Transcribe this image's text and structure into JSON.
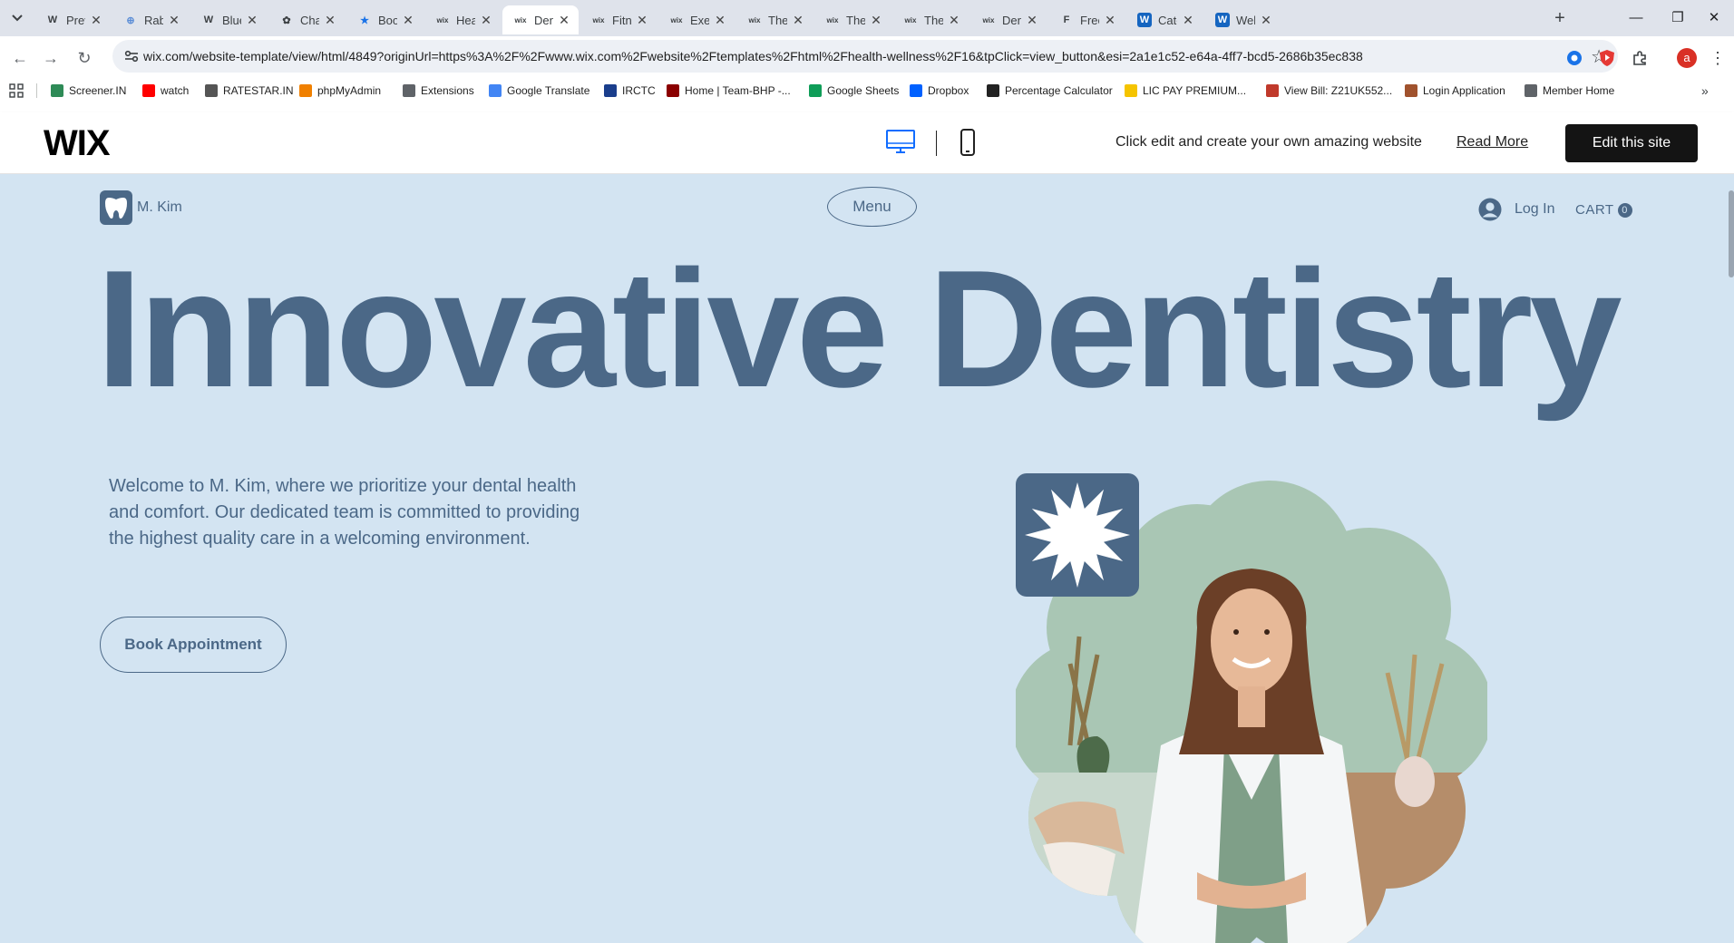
{
  "browser": {
    "tabs": [
      {
        "title": "Preval",
        "icon": "wikipedia-icon",
        "glyph": "W"
      },
      {
        "title": "Rabies",
        "icon": "globe-icon",
        "glyph": "⊕"
      },
      {
        "title": "Blue C",
        "icon": "wikipedia-icon",
        "glyph": "W"
      },
      {
        "title": "ChatG",
        "icon": "chatgpt-icon",
        "glyph": "✿"
      },
      {
        "title": "Bookn",
        "icon": "bookmark-star-icon",
        "glyph": "★"
      },
      {
        "title": "Health",
        "icon": "wix-favicon-icon",
        "glyph": "wix"
      },
      {
        "title": "Dentis",
        "icon": "wix-favicon-icon",
        "glyph": "wix"
      },
      {
        "title": "Fitnes",
        "icon": "wix-favicon-icon",
        "glyph": "wix"
      },
      {
        "title": "Exerci",
        "icon": "wix-favicon-icon",
        "glyph": "wix"
      },
      {
        "title": "Thera",
        "icon": "wix-favicon-icon",
        "glyph": "wix"
      },
      {
        "title": "Thera",
        "icon": "wix-favicon-icon",
        "glyph": "wix"
      },
      {
        "title": "Thera",
        "icon": "wix-favicon-icon",
        "glyph": "wix"
      },
      {
        "title": "Dentis",
        "icon": "wix-favicon-icon",
        "glyph": "wix"
      },
      {
        "title": "Free C",
        "icon": "framer-icon",
        "glyph": "F"
      },
      {
        "title": "Categ",
        "icon": "webflow-icon",
        "glyph": "W"
      },
      {
        "title": "Welln",
        "icon": "webflow-icon",
        "glyph": "W"
      }
    ],
    "active_tab_index": 6,
    "url": "wix.com/website-template/view/html/4849?originUrl=https%3A%2F%2Fwww.wix.com%2Fwebsite%2Ftemplates%2Fhtml%2Fhealth-wellness%2F16&tpClick=view_button&esi=2a1e1c52-e64a-4ff7-bcd5-2686b35ec838",
    "profile_initial": "a",
    "bookmarks": [
      {
        "label": "Screener.IN",
        "icon": "bar-chart-icon",
        "color": "#2e8b57"
      },
      {
        "label": "watch",
        "icon": "youtube-icon",
        "color": "#ff0000"
      },
      {
        "label": "RATESTAR.IN",
        "icon": "star-burst-icon",
        "color": "#555555"
      },
      {
        "label": "phpMyAdmin",
        "icon": "phpmyadmin-icon",
        "color": "#f08000"
      },
      {
        "label": "Extensions",
        "icon": "puzzle-icon",
        "color": "#5f6368"
      },
      {
        "label": "Google Translate",
        "icon": "translate-icon",
        "color": "#4285f4"
      },
      {
        "label": "IRCTC",
        "icon": "irctc-icon",
        "color": "#1a3e8c"
      },
      {
        "label": "Home | Team-BHP -...",
        "icon": "team-bhp-icon",
        "color": "#8b0000"
      },
      {
        "label": "Google Sheets",
        "icon": "sheets-icon",
        "color": "#0f9d58"
      },
      {
        "label": "Dropbox",
        "icon": "dropbox-icon",
        "color": "#0061ff"
      },
      {
        "label": "Percentage Calculator",
        "icon": "percent-icon",
        "color": "#222222"
      },
      {
        "label": "LIC PAY PREMIUM...",
        "icon": "lic-icon",
        "color": "#f5c400"
      },
      {
        "label": "View Bill: Z21UK552...",
        "icon": "bill-icon",
        "color": "#c0392b"
      },
      {
        "label": "Login Application",
        "icon": "login-app-icon",
        "color": "#a0522d"
      },
      {
        "label": "Member Home",
        "icon": "globe-icon",
        "color": "#5f6368"
      }
    ]
  },
  "wix_bar": {
    "logo": "WIX",
    "tagline": "Click edit and create your own amazing website",
    "read_more": "Read More",
    "edit_button": "Edit this site"
  },
  "site": {
    "brand_name": "M. Kim",
    "menu_label": "Menu",
    "login_label": "Log In",
    "cart_label": "CART",
    "cart_count": "0",
    "hero_title": "Innovative Dentistry",
    "intro": "Welcome to M. Kim, where we prioritize your dental health and comfort. Our dedicated team is committed to providing the highest quality care in a welcoming environment.",
    "cta_label": "Book Appointment"
  },
  "colors": {
    "site_background": "#d3e4f2",
    "brand_blue": "#4b6887",
    "image_green": "#a9c6b4",
    "tab_strip": "#dfe3eb"
  }
}
